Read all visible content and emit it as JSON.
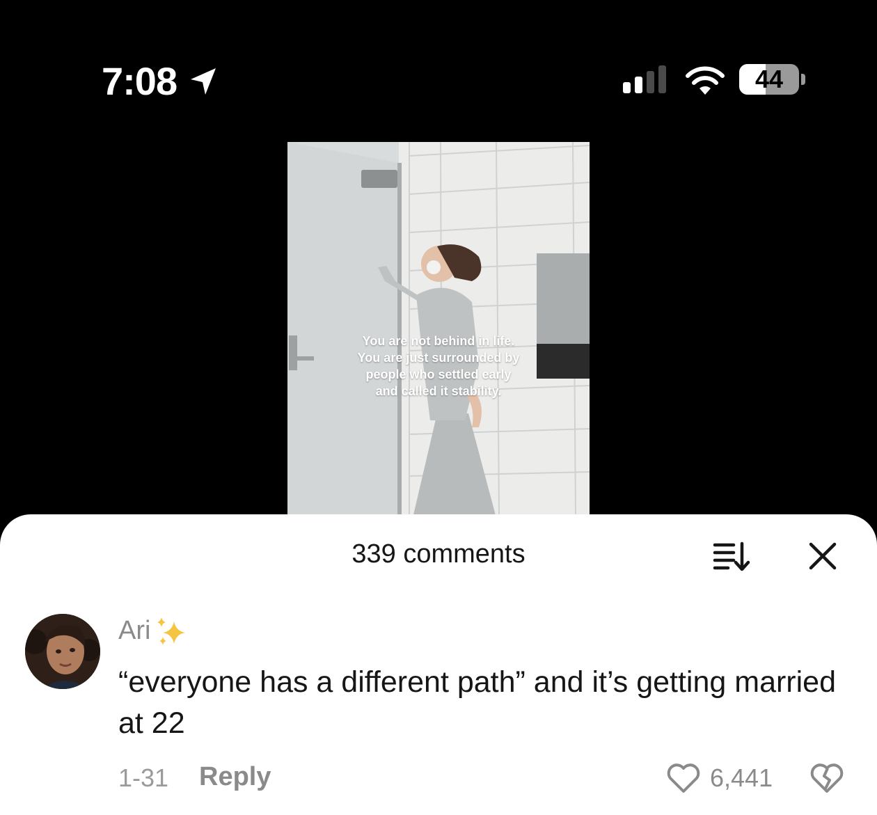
{
  "status_bar": {
    "time": "7:08",
    "battery_level": "44",
    "battery_fraction": 0.44,
    "icons": [
      "location-arrow-icon",
      "cellular-signal-icon",
      "wifi-icon",
      "battery-icon"
    ]
  },
  "video": {
    "caption_lines": [
      "You are not behind in life.",
      "You are just surrounded by",
      "people who settled early",
      "and called it stability."
    ]
  },
  "comments_sheet": {
    "count_label": "339 comments",
    "icons": [
      "sort-icon",
      "close-icon"
    ],
    "comment": {
      "username": "Ari",
      "username_icon": "sparkles-icon",
      "text": "“everyone has a different path” and it’s getting married at 22",
      "date": "1-31",
      "reply_label": "Reply",
      "like_count": "6,441",
      "icons": [
        "heart-icon",
        "dislike-icon"
      ]
    }
  },
  "colors": {
    "background": "#000000",
    "sheet": "#ffffff",
    "primary_text": "#161616",
    "secondary_text": "#8a8a8a",
    "sparkle": "#f5c542"
  }
}
